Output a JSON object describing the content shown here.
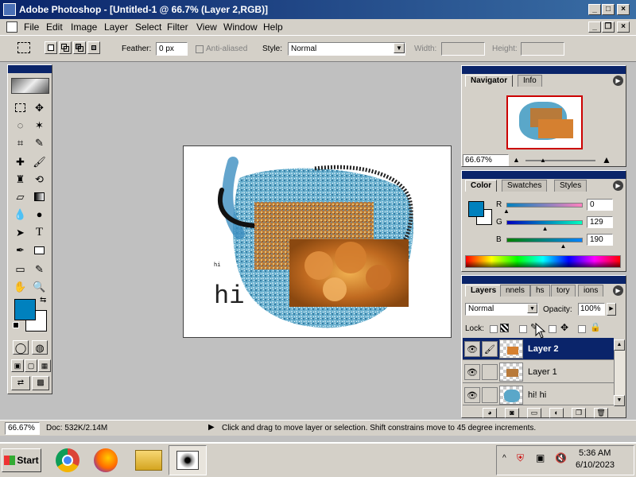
{
  "window": {
    "title": "Adobe Photoshop - [Untitled-1 @ 66.7% (Layer 2,RGB)]"
  },
  "menu": [
    "File",
    "Edit",
    "Image",
    "Layer",
    "Select",
    "Filter",
    "View",
    "Window",
    "Help"
  ],
  "options": {
    "feather_label": "Feather:",
    "feather_value": "0 px",
    "antialiased_label": "Anti-aliased",
    "style_label": "Style:",
    "style_value": "Normal",
    "width_label": "Width:",
    "height_label": "Height:"
  },
  "canvas": {
    "text": "hi",
    "small_text": "hi"
  },
  "navigator": {
    "tabs": [
      "Navigator",
      "Info"
    ],
    "zoom": "66.67%"
  },
  "color": {
    "tabs": [
      "Color",
      "Swatches",
      "Styles"
    ],
    "r_label": "R",
    "g_label": "G",
    "b_label": "B",
    "r_value": "0",
    "g_value": "129",
    "b_value": "190",
    "r_level": 0,
    "g_level": 0.506,
    "b_level": 0.745,
    "fg_color": "#0081be"
  },
  "layers": {
    "tabs": [
      "Layers",
      "nnels",
      "hs",
      "tory",
      "ions"
    ],
    "blend_mode": "Normal",
    "opacity_label": "Opacity:",
    "opacity_value": "100%",
    "lock_label": "Lock:",
    "items": [
      {
        "name": "Layer 2",
        "selected": true
      },
      {
        "name": "Layer 1",
        "selected": false
      },
      {
        "name": "hi! hi",
        "selected": false
      }
    ]
  },
  "status": {
    "zoom": "66.67%",
    "doc": "Doc: 532K/2.14M",
    "message": "Click and drag to move layer or selection. Shift constrains move to 45 degree increments."
  },
  "taskbar": {
    "start_label": "Start",
    "time": "5:36 AM",
    "date": "6/10/2023",
    "apps": [
      "chrome-icon",
      "firefox-icon",
      "file-explorer-icon",
      "photoshop-icon"
    ]
  },
  "colors": {
    "title_dark": "#0a246a",
    "title_light": "#3a6ea5",
    "ui_gray": "#d4d0c8"
  }
}
